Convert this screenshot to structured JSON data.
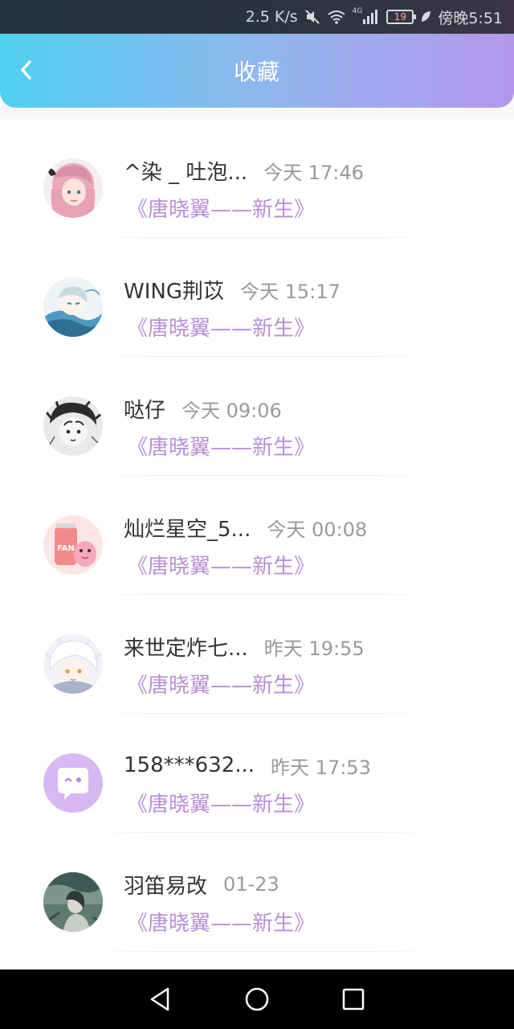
{
  "status_bar": {
    "speed": "2.5 K/s",
    "network": "4G",
    "battery": "19",
    "time": "傍晚5:51"
  },
  "header": {
    "title": "收藏"
  },
  "favorites": [
    {
      "name": "^染 _ 吐泡...",
      "time": "今天 17:46",
      "work": "《唐晓翼——新生》"
    },
    {
      "name": "WING荆苡",
      "time": "今天 15:17",
      "work": "《唐晓翼——新生》"
    },
    {
      "name": "哒仔",
      "time": "今天 09:06",
      "work": "《唐晓翼——新生》"
    },
    {
      "name": "灿烂星空_5...",
      "time": "今天 00:08",
      "work": "《唐晓翼——新生》"
    },
    {
      "name": "来世定炸七...",
      "time": "昨天 19:55",
      "work": "《唐晓翼——新生》"
    },
    {
      "name": "158***632...",
      "time": "昨天 17:53",
      "work": "《唐晓翼——新生》"
    },
    {
      "name": "羽笛易改",
      "time": "01-23",
      "work": "《唐晓翼——新生》"
    }
  ],
  "avatar_icons": [
    "pink-hair-avatar",
    "blue-ink-avatar",
    "sketch-boy-avatar",
    "fanta-can-avatar",
    "white-hair-avatar",
    "default-chat-avatar",
    "forest-girl-avatar"
  ],
  "colors": {
    "header_start": "#4fd1f0",
    "header_end": "#b497ea",
    "work_title": "#b88fd6",
    "default_avatar": "#d8b8f2"
  }
}
